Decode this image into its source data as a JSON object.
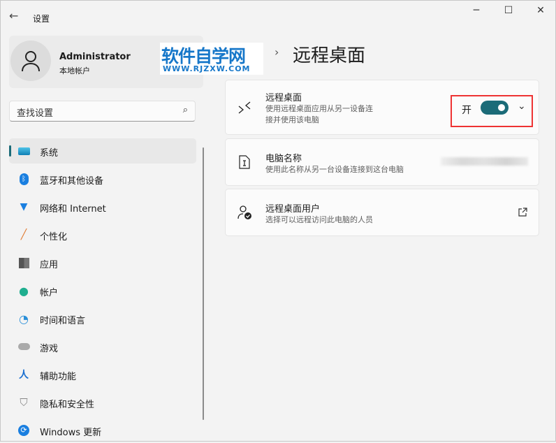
{
  "window": {
    "title": "设置",
    "back": "←",
    "minimize": "─",
    "maximize": "☐",
    "close": "✕"
  },
  "profile": {
    "name": "Administrator",
    "account_type": "本地帐户"
  },
  "search": {
    "placeholder": "查找设置",
    "icon": "search-icon"
  },
  "nav": [
    {
      "label": "系统",
      "icon": "system-icon",
      "selected": true
    },
    {
      "label": "蓝牙和其他设备",
      "icon": "bluetooth-icon"
    },
    {
      "label": "网络和 Internet",
      "icon": "wifi-icon"
    },
    {
      "label": "个性化",
      "icon": "brush-icon"
    },
    {
      "label": "应用",
      "icon": "apps-icon"
    },
    {
      "label": "帐户",
      "icon": "account-icon"
    },
    {
      "label": "时间和语言",
      "icon": "time-language-icon"
    },
    {
      "label": "游戏",
      "icon": "gamepad-icon"
    },
    {
      "label": "辅助功能",
      "icon": "accessibility-icon"
    },
    {
      "label": "隐私和安全性",
      "icon": "shield-icon"
    },
    {
      "label": "Windows 更新",
      "icon": "update-icon"
    }
  ],
  "watermark": {
    "text": "软件自学网",
    "url": "WWW.RJZXW.COM"
  },
  "breadcrumb": {
    "separator": "›",
    "title": "远程桌面"
  },
  "cards": [
    {
      "title": "远程桌面",
      "subtitle": "使用远程桌面应用从另一设备连接并使用该电脑",
      "subtitle_line1": "使用远程桌面应用从另一设备连",
      "subtitle_line2": "接并使用该电脑",
      "toggle_label": "开",
      "toggle_on": true
    },
    {
      "title": "电脑名称",
      "subtitle": "使用此名称从另一台设备连接到这台电脑"
    },
    {
      "title": "远程桌面用户",
      "subtitle": "选择可以远程访问此电脑的人员"
    }
  ],
  "colors": {
    "accent": "#1b6b78",
    "highlight": "#e33333",
    "watermark": "#1677c9"
  }
}
